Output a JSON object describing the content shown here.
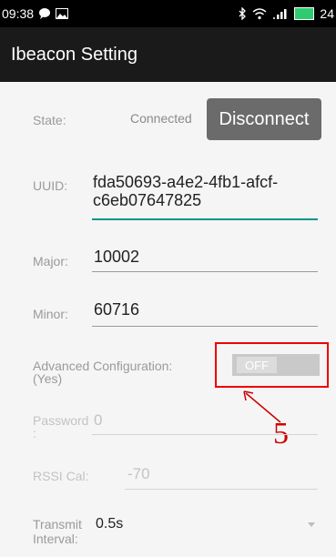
{
  "status_bar": {
    "time": "09:38",
    "right_text": "24",
    "icons": [
      "chat-bubble-icon",
      "image-icon",
      "bluetooth-icon",
      "wifi-icon",
      "signal-icon",
      "battery-icon"
    ]
  },
  "app_bar": {
    "title": "Ibeacon Setting"
  },
  "state": {
    "label": "State:",
    "value": "Connected",
    "button": "Disconnect"
  },
  "uuid": {
    "label": "UUID:",
    "line1": "fda50693-a4e2-4fb1-afcf-",
    "line2": "c6eb07647825"
  },
  "major": {
    "label": "Major:",
    "value": "10002"
  },
  "minor": {
    "label": "Minor:",
    "value": "60716"
  },
  "advanced": {
    "label_line1": "Advanced Configuration:",
    "label_line2": "(Yes)",
    "toggle_text": "OFF"
  },
  "password": {
    "label_line1": "Password",
    "label_line2": ":",
    "value": "0"
  },
  "rssi": {
    "label": "RSSI Cal:",
    "value": "-70"
  },
  "transmit": {
    "label_line1": "Transmit",
    "label_line2": "Interval:",
    "value": "0.5s"
  },
  "annotation": {
    "number": "5"
  },
  "colors": {
    "statusbar": "#000000",
    "appbar": "#1a1a1a",
    "accent": "#009688",
    "annotation": "#e00000",
    "button": "#6b6b6b"
  }
}
